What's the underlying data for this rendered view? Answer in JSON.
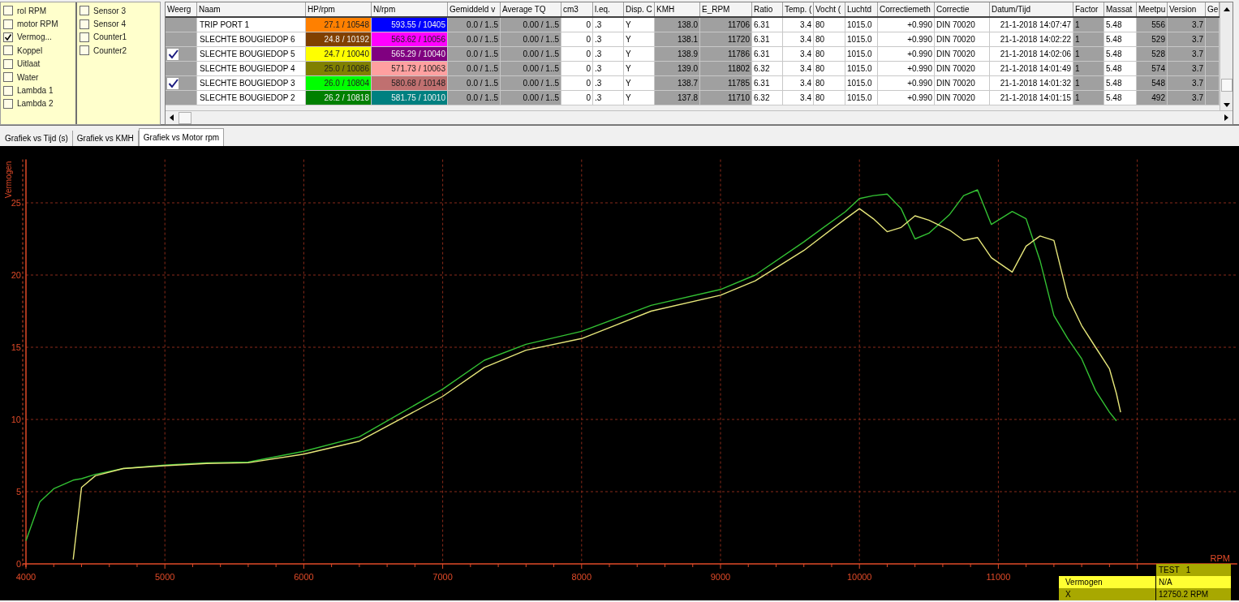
{
  "channel_panel": {
    "columns": [
      [
        {
          "label": "rol RPM",
          "checked": false
        },
        {
          "label": "motor RPM",
          "checked": false
        },
        {
          "label": "Vermog...",
          "checked": true
        },
        {
          "label": "Koppel",
          "checked": false
        },
        {
          "label": "Uitlaat",
          "checked": false
        },
        {
          "label": "Water",
          "checked": false
        },
        {
          "label": "Lambda 1",
          "checked": false
        },
        {
          "label": "Lambda 2",
          "checked": false
        }
      ],
      [
        {
          "label": "Sensor 3",
          "checked": false
        },
        {
          "label": "Sensor 4",
          "checked": false
        },
        {
          "label": "Counter1",
          "checked": false
        },
        {
          "label": "Counter2",
          "checked": false
        }
      ]
    ]
  },
  "table": {
    "columns": [
      {
        "label": "Weerg",
        "shaded": true
      },
      {
        "label": "Naam"
      },
      {
        "label": "HP/rpm"
      },
      {
        "label": "N/rpm"
      },
      {
        "label": "Gemiddeld v",
        "shaded": true
      },
      {
        "label": "Average TQ",
        "shaded": true
      },
      {
        "label": "cm3"
      },
      {
        "label": "l.eq."
      },
      {
        "label": "Disp. C"
      },
      {
        "label": "KMH",
        "shaded": true
      },
      {
        "label": "E_RPM",
        "shaded": true
      },
      {
        "label": "Ratio"
      },
      {
        "label": "Temp. ("
      },
      {
        "label": "Vocht ("
      },
      {
        "label": "Luchtd"
      },
      {
        "label": "Correctiemeth"
      },
      {
        "label": "Correctie"
      },
      {
        "label": "Datum/Tijd"
      },
      {
        "label": "Factor",
        "shaded": true
      },
      {
        "label": "Massat"
      },
      {
        "label": "Meetpu",
        "shaded": true
      },
      {
        "label": "Version",
        "shaded": true
      },
      {
        "label": "Ge",
        "shaded": true
      }
    ],
    "rows": [
      {
        "shown": false,
        "cells": [
          "",
          "TRIP PORT 1",
          {
            "text": "27.1 / 10548",
            "color": "#ff8000"
          },
          {
            "text": "593.55 / 10405",
            "color": "#0000ff"
          },
          "0.0 / 1..5",
          "0.00 / 1..5",
          "0",
          ".3",
          "Y",
          "138.0",
          "11706",
          "6.31",
          "3.4",
          "80",
          "1015.0",
          "+0.990",
          "DIN 70020",
          "21-1-2018 14:07:47",
          "1",
          "5.48",
          "556",
          "3.7"
        ]
      },
      {
        "shown": false,
        "cells": [
          "",
          "SLECHTE BOUGIEDOP 6",
          {
            "text": "24.8 / 10192",
            "color": "#804000"
          },
          {
            "text": "563.62 / 10056",
            "color": "#ff00ff"
          },
          "0.0 / 1..5",
          "0.00 / 1..5",
          "0",
          ".3",
          "Y",
          "138.1",
          "11720",
          "6.31",
          "3.4",
          "80",
          "1015.0",
          "+0.990",
          "DIN 70020",
          "21-1-2018 14:02:22",
          "1",
          "5.48",
          "529",
          "3.7"
        ]
      },
      {
        "shown": true,
        "cells": [
          "",
          "SLECHTE BOUGIEDOP 5",
          {
            "text": "24.7 / 10040",
            "color": "#ffff00"
          },
          {
            "text": "565.29 / 10040",
            "color": "#800080"
          },
          "0.0 / 1..5",
          "0.00 / 1..5",
          "0",
          ".3",
          "Y",
          "138.9",
          "11786",
          "6.31",
          "3.4",
          "80",
          "1015.0",
          "+0.990",
          "DIN 70020",
          "21-1-2018 14:02:06",
          "1",
          "5.48",
          "528",
          "3.7"
        ]
      },
      {
        "shown": false,
        "cells": [
          "",
          "SLECHTE BOUGIEDOP 4",
          {
            "text": "25.0 / 10086",
            "color": "#808000"
          },
          {
            "text": "571.73 / 10063",
            "color": "#ffa0a0"
          },
          "0.0 / 1..5",
          "0.00 / 1..5",
          "0",
          ".3",
          "Y",
          "139.0",
          "11802",
          "6.32",
          "3.4",
          "80",
          "1015.0",
          "+0.990",
          "DIN 70020",
          "21-1-2018 14:01:49",
          "1",
          "5.48",
          "574",
          "3.7"
        ]
      },
      {
        "shown": true,
        "cells": [
          "",
          "SLECHTE BOUGIEDOP 3",
          {
            "text": "26.0 / 10804",
            "color": "#00ff00"
          },
          {
            "text": "580.68 / 10148",
            "color": "#c07070"
          },
          "0.0 / 1..5",
          "0.00 / 1..5",
          "0",
          ".3",
          "Y",
          "138.7",
          "11785",
          "6.31",
          "3.4",
          "80",
          "1015.0",
          "+0.990",
          "DIN 70020",
          "21-1-2018 14:01:32",
          "1",
          "5.48",
          "548",
          "3.7"
        ]
      },
      {
        "shown": false,
        "cells": [
          "",
          "SLECHTE BOUGIEDOP 2",
          {
            "text": "26.2 / 10818",
            "color": "#008000"
          },
          {
            "text": "581.75 / 10010",
            "color": "#008080"
          },
          "0.0 / 1..5",
          "0.00 / 1..5",
          "0",
          ".3",
          "Y",
          "137.8",
          "11710",
          "6.32",
          "3.4",
          "80",
          "1015.0",
          "+0.990",
          "DIN 70020",
          "21-1-2018 14:01:15",
          "1",
          "5.48",
          "492",
          "3.7"
        ]
      }
    ]
  },
  "tabs": [
    {
      "label": "Grafiek vs Tijd (s)",
      "selected": false
    },
    {
      "label": "Grafiek vs KMH",
      "selected": false
    },
    {
      "label": "Grafiek vs Motor rpm",
      "selected": true
    }
  ],
  "chart": {
    "chart_data": {
      "type": "line",
      "xlabel": "RPM",
      "ylabel": "Vermogen",
      "grid": true,
      "xlim": [
        3990,
        12720
      ],
      "ylim": [
        0,
        28
      ],
      "xticks": [
        4000,
        5000,
        6000,
        7000,
        8000,
        9000,
        10000,
        11000
      ],
      "yticks": [
        0,
        5,
        10,
        15,
        20,
        25
      ],
      "x": [
        4000,
        4100,
        4200,
        4340,
        4400,
        4500,
        4700,
        5000,
        5300,
        5600,
        6000,
        6400,
        7000,
        7300,
        7600,
        8000,
        8500,
        9000,
        9250,
        9600,
        9900,
        10000,
        10100,
        10200,
        10300,
        10400,
        10500,
        10650,
        10750,
        10850,
        10950,
        11100,
        11200,
        11300,
        11400,
        11500,
        11600,
        11700,
        11800,
        11850,
        11880
      ],
      "series": [
        {
          "color": "#33c033",
          "values": [
            1.6,
            4.3,
            5.2,
            5.8,
            5.9,
            6.2,
            6.6,
            6.85,
            7.0,
            7.05,
            7.8,
            8.8,
            12.1,
            14.1,
            15.2,
            16.1,
            17.9,
            19.0,
            20.0,
            22.3,
            24.4,
            25.3,
            25.5,
            25.6,
            24.6,
            22.5,
            22.9,
            24.2,
            25.5,
            25.9,
            23.5,
            24.4,
            23.9,
            21.0,
            17.2,
            15.6,
            14.2,
            12.0,
            10.5,
            9.9,
            null
          ]
        },
        {
          "color": "#e6e67a",
          "values": [
            null,
            null,
            null,
            0.3,
            5.3,
            6.1,
            6.6,
            6.8,
            6.95,
            7.0,
            7.6,
            8.5,
            11.6,
            13.6,
            14.8,
            15.6,
            17.5,
            18.6,
            19.6,
            21.7,
            23.9,
            24.6,
            23.9,
            23.0,
            23.3,
            24.1,
            23.8,
            23.1,
            22.4,
            22.6,
            21.2,
            20.2,
            22.0,
            22.7,
            22.4,
            18.5,
            16.5,
            15.0,
            13.5,
            11.8,
            10.5
          ]
        }
      ]
    }
  },
  "legend": {
    "title": "TEST   1",
    "rows": [
      {
        "label": "Vermogen",
        "value": "N/A",
        "highlighted": true
      },
      {
        "label": "X",
        "value": "12750.2 RPM",
        "highlighted": false
      }
    ]
  }
}
